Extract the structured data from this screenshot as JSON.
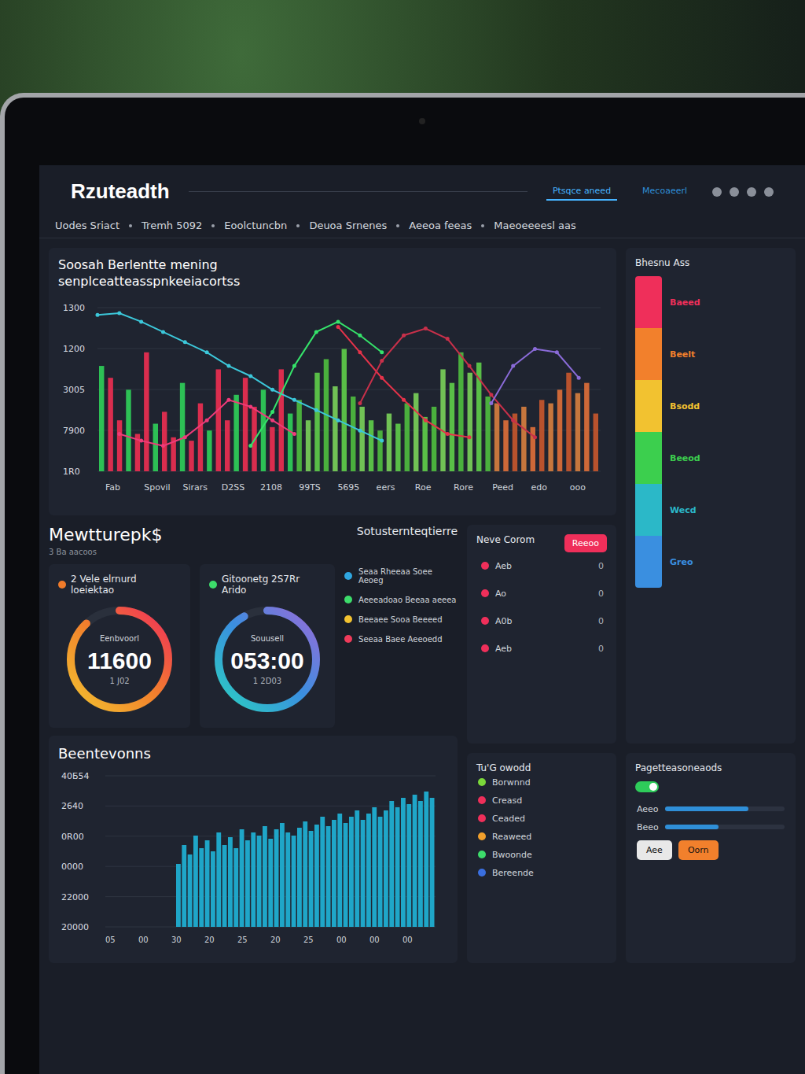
{
  "logo": "Rzuteadth",
  "header_tabs": [
    {
      "label": "Ptsqce aneed",
      "selected": true
    },
    {
      "label": "Mecoaeerl",
      "selected": false
    }
  ],
  "nav": [
    "Uodes Sriact",
    "Tremh 5092",
    "Eoolctuncbn",
    "Deuoa Srnenes",
    "Aeeoa feeas",
    "Maeoeeeesl aas"
  ],
  "main_chart": {
    "title": [
      "Soosah Berlentte mening",
      "senplceatteasspnkeeiacortss"
    ],
    "y_ticks": [
      "1300",
      "1200",
      "3005",
      "7900",
      "1R0"
    ],
    "x_labels": [
      "Fab",
      "Spovil",
      "Sirars",
      "D2SS",
      "2108",
      "99TS",
      "5695",
      "eers",
      "Roe",
      "Rore",
      "Peed",
      "edo",
      "ooo"
    ],
    "bars": [
      62,
      55,
      30,
      48,
      22,
      70,
      28,
      35,
      20,
      52,
      18,
      40,
      24,
      60,
      30,
      45,
      55,
      38,
      48,
      26,
      60,
      34,
      42,
      30,
      58,
      66,
      50,
      72,
      44,
      38,
      30,
      24,
      34,
      28,
      40,
      46,
      32,
      38,
      60,
      52,
      70,
      58,
      64,
      44,
      40,
      30,
      34,
      38,
      26,
      42,
      40,
      48,
      58,
      46,
      52,
      34
    ],
    "lines": [
      {
        "color": "#3cc8da",
        "offset": 0,
        "values": [
          92,
          93,
          88,
          82,
          76,
          70,
          62,
          56,
          48,
          42,
          36,
          30,
          24,
          18
        ]
      },
      {
        "color": "#35e36a",
        "offset": 7,
        "values": [
          15,
          35,
          62,
          82,
          88,
          80,
          70
        ]
      },
      {
        "color": "#e5334a",
        "offset": 11,
        "values": [
          85,
          70,
          55,
          42,
          30,
          22,
          20
        ]
      },
      {
        "color": "#c8304a",
        "offset": 12,
        "values": [
          40,
          65,
          80,
          84,
          78,
          62,
          45,
          30,
          20
        ]
      },
      {
        "color": "#8a6bd8",
        "offset": 18,
        "values": [
          40,
          62,
          72,
          70,
          55
        ]
      },
      {
        "color": "#ef3b7a",
        "offset": 1,
        "values": [
          22,
          18,
          15,
          20,
          30,
          42,
          38,
          30,
          22
        ]
      }
    ]
  },
  "section": {
    "title": "Mewtturepk$",
    "subtitle": "3 Ba aacoos",
    "caption": "Sotusternteqtierre"
  },
  "gauges": [
    {
      "title": "2 Vele elrnurd loeiektao",
      "color": "#f07b2a",
      "label": "Eenbvoorl",
      "value": "11600",
      "sub": "1 J02",
      "level": 0.88
    },
    {
      "title": "Gitoonetg 2S7Rr Arido",
      "color": "#3ddc6b",
      "label": "Souusell",
      "value": "053:00",
      "sub": "1 2D03",
      "level": 0.92
    }
  ],
  "legend": [
    {
      "label": "Seaa Rheeaa Soee Aeoeg",
      "color": "#2fa6e0"
    },
    {
      "label": "Aeeeadoao Beeaa aeeea",
      "color": "#3ddc6b"
    },
    {
      "label": "Beeaee Sooa Beeeed",
      "color": "#f2c230"
    },
    {
      "label": "Seeaa Baee Aeeoedd",
      "color": "#ef3b5a"
    }
  ],
  "bottom_chart": {
    "title": "Beentevonns",
    "y_ticks": [
      "40Б54",
      "2640",
      "0R00",
      "0000",
      "22000",
      "20000"
    ],
    "x_labels": [
      "05",
      "00",
      "30",
      "20",
      "25",
      "20",
      "25",
      "00",
      "00",
      "00"
    ],
    "bars": [
      40,
      52,
      46,
      58,
      50,
      55,
      48,
      60,
      52,
      57,
      50,
      62,
      55,
      60,
      58,
      64,
      56,
      62,
      66,
      60,
      58,
      63,
      67,
      61,
      65,
      70,
      64,
      68,
      72,
      66,
      70,
      74,
      68,
      72,
      76,
      70,
      74,
      80,
      76,
      82,
      78,
      84,
      80,
      86,
      82
    ]
  },
  "rainbow": {
    "title": "Bhesnu Ass",
    "items": [
      {
        "label": "Baeed",
        "color": "#ef2f5a"
      },
      {
        "label": "Beelt",
        "color": "#f2802c"
      },
      {
        "label": "Bsodd",
        "color": "#f2c230"
      },
      {
        "label": "Beeod",
        "color": "#3ccf4e"
      },
      {
        "label": "Wecd",
        "color": "#2bb8c8"
      },
      {
        "label": "Greo",
        "color": "#3a8fe0"
      }
    ]
  },
  "alerts": {
    "title": "Neve Corom",
    "button": "Reeoo",
    "rows": [
      {
        "label": "Aeb",
        "value": "0",
        "color": "#ef2f5a"
      },
      {
        "label": "Ao",
        "value": "0",
        "color": "#ef2f5a"
      },
      {
        "label": "A0b",
        "value": "0",
        "color": "#ef2f5a"
      },
      {
        "label": "Aeb",
        "value": "0",
        "color": "#ef2f5a"
      }
    ]
  },
  "list": {
    "title": "Tu'G owodd",
    "items": [
      {
        "label": "Borwnnd",
        "color": "#7bd83a"
      },
      {
        "label": "Creasd",
        "color": "#ef2f5a"
      },
      {
        "label": "Ceaded",
        "color": "#ef2f5a"
      },
      {
        "label": "Reaweed",
        "color": "#f2a02c"
      },
      {
        "label": "Bwoonde",
        "color": "#3ddc6b"
      },
      {
        "label": "Bereende",
        "color": "#3a6fe0"
      }
    ]
  },
  "extra": {
    "title": "Pagetteasoneaods",
    "toggle_on": true,
    "rows": [
      {
        "label": "Aeeo",
        "level": 0.7
      },
      {
        "label": "Beeo",
        "level": 0.45
      }
    ],
    "buttons": [
      {
        "label": "Aee",
        "color": "#e8e8e8"
      },
      {
        "label": "Oorn",
        "color": "#f2802c"
      }
    ]
  }
}
